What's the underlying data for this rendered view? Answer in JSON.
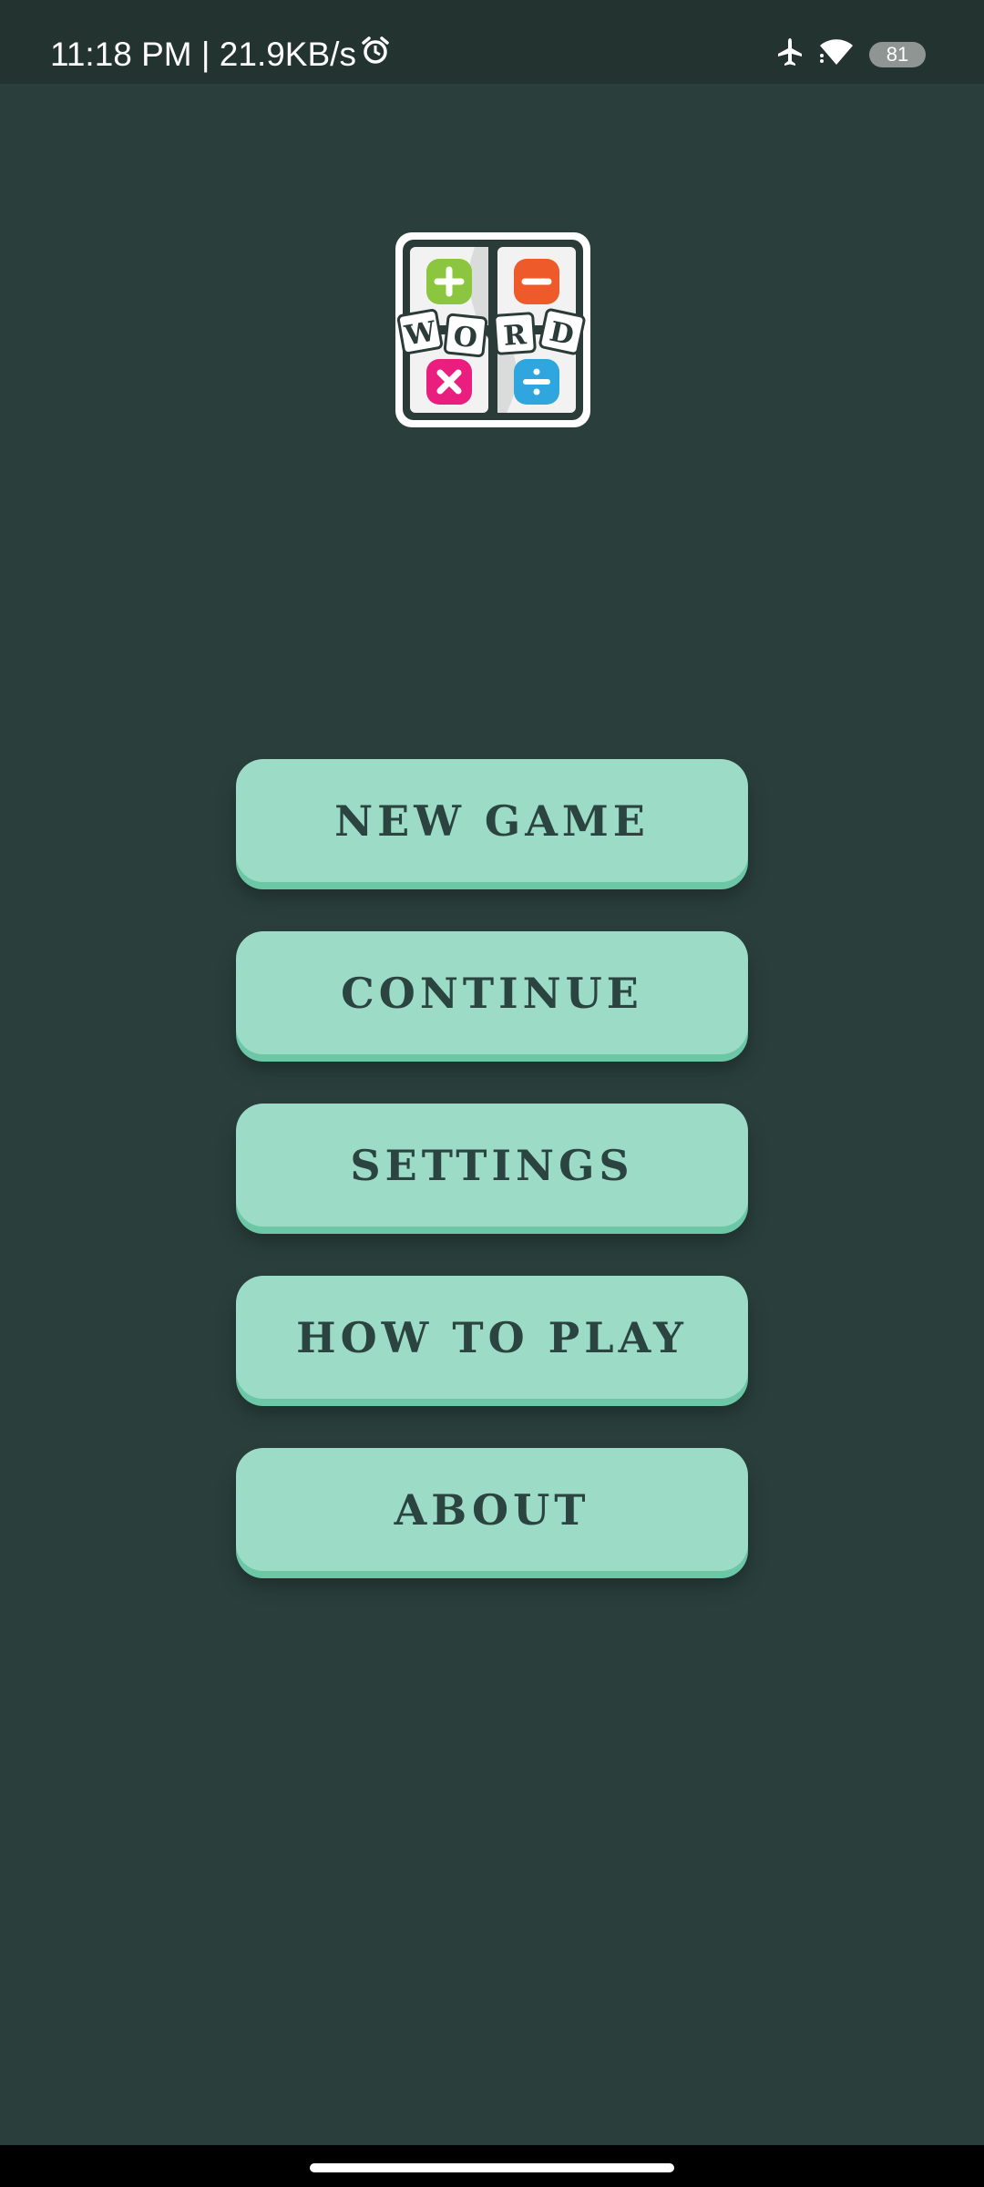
{
  "status_bar": {
    "time_text": "11:18 PM | 21.9KB/s",
    "alarm_icon": "alarm-icon",
    "airplane_icon": "airplane-icon",
    "wifi_icon": "wifi-icon",
    "battery_level": "81"
  },
  "logo": {
    "letters": [
      "W",
      "O",
      "R",
      "D"
    ],
    "colors": {
      "plus": "#8cc63f",
      "minus": "#ef5a2a",
      "times": "#e91e7f",
      "divide": "#2fa6dd",
      "frame": "#2b3b38"
    }
  },
  "menu": {
    "new_game": "NEW GAME",
    "continue": "CONTINUE",
    "settings": "SETTINGS",
    "how_to_play": "HOW TO PLAY",
    "about": "ABOUT"
  },
  "colors": {
    "background": "#2a3f3c",
    "status_bar": "#223330",
    "button": "#9cdcc6",
    "button_shadow": "#6cc7a7",
    "button_text": "#2b4440"
  }
}
